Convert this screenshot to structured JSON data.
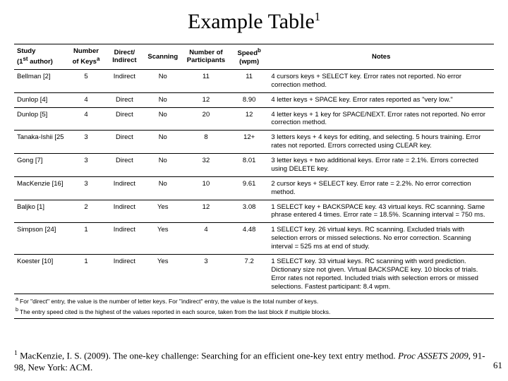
{
  "title": "Example Table",
  "title_sup": "1",
  "headers": {
    "study": "Study",
    "study_sub": "(1",
    "study_sub2": " author)",
    "study_sup": "st",
    "num_keys": "Number of Keys",
    "num_keys_sup": "a",
    "di": "Direct/ Indirect",
    "scan": "Scanning",
    "participants": "Number of Participants",
    "speed": "Speed",
    "speed_sup": "b",
    "speed_unit": "(wpm)",
    "notes": "Notes"
  },
  "rows": [
    {
      "study": "Bellman [2]",
      "keys": "5",
      "di": "Indirect",
      "scan": "No",
      "part": "11",
      "speed": "11",
      "notes": "4 cursors keys + SELECT key.  Error rates not reported.  No error correction method."
    },
    {
      "study": "Dunlop [4]",
      "keys": "4",
      "di": "Direct",
      "scan": "No",
      "part": "12",
      "speed": "8.90",
      "notes": "4 letter keys + SPACE key.  Error rates reported as \"very low.\""
    },
    {
      "study": "Dunlop [5]",
      "keys": "4",
      "di": "Direct",
      "scan": "No",
      "part": "20",
      "speed": "12",
      "notes": "4 letter keys + 1 key for SPACE/NEXT.  Error rates not reported.  No error correction method."
    },
    {
      "study": "Tanaka-Ishii [25",
      "keys": "3",
      "di": "Direct",
      "scan": "No",
      "part": "8",
      "speed": "12+",
      "notes": "3 letters keys + 4 keys for editing, and selecting. 5 hours training. Error rates not reported.  Errors corrected using CLEAR key."
    },
    {
      "study": "Gong [7]",
      "keys": "3",
      "di": "Direct",
      "scan": "No",
      "part": "32",
      "speed": "8.01",
      "notes": "3 letter keys + two additional keys.  Error rate = 2.1%.  Errors corrected using DELETE key."
    },
    {
      "study": "MacKenzie [16]",
      "keys": "3",
      "di": "Indirect",
      "scan": "No",
      "part": "10",
      "speed": "9.61",
      "notes": "2 cursor keys + SELECT key.  Error rate = 2.2%.  No error correction method."
    },
    {
      "study": "Baljko [1]",
      "keys": "2",
      "di": "Indirect",
      "scan": "Yes",
      "part": "12",
      "speed": "3.08",
      "notes": "1 SELECT key + BACKSPACE key. 43 virtual keys.  RC scanning.  Same phrase entered 4 times.  Error rate = 18.5%.  Scanning interval = 750 ms."
    },
    {
      "study": "Simpson [24]",
      "keys": "1",
      "di": "Indirect",
      "scan": "Yes",
      "part": "4",
      "speed": "4.48",
      "notes": "1 SELECT key. 26 virtual keys.  RC scanning.  Excluded trials with selection errors or missed selections.  No error correction.  Scanning interval = 525 ms at end of study."
    },
    {
      "study": "Koester [10]",
      "keys": "1",
      "di": "Indirect",
      "scan": "Yes",
      "part": "3",
      "speed": "7.2",
      "notes": "1 SELECT key. 33 virtual keys. RC scanning with word prediction.  Dictionary size not given.  Virtual BACKSPACE key. 10 blocks of trials.  Error rates not reported.  Included trials with selection errors or missed selections.  Fastest participant: 8.4 wpm."
    }
  ],
  "table_footnotes": {
    "a": "For \"direct\" entry, the value is the number of letter keys.  For \"indirect\" entry, the value is the total number of keys.",
    "b": "The entry speed cited is the highest of the values reported in each source, taken from the last block if multiple blocks."
  },
  "citation": {
    "sup": "1",
    "text1": " MacKenzie, I. S. (2009). The one-key challenge: Searching for an efficient one-key text entry method. ",
    "text2": "Proc ASSETS 2009",
    "text3": ", 91-98, New York: ACM."
  },
  "page_number": "61"
}
